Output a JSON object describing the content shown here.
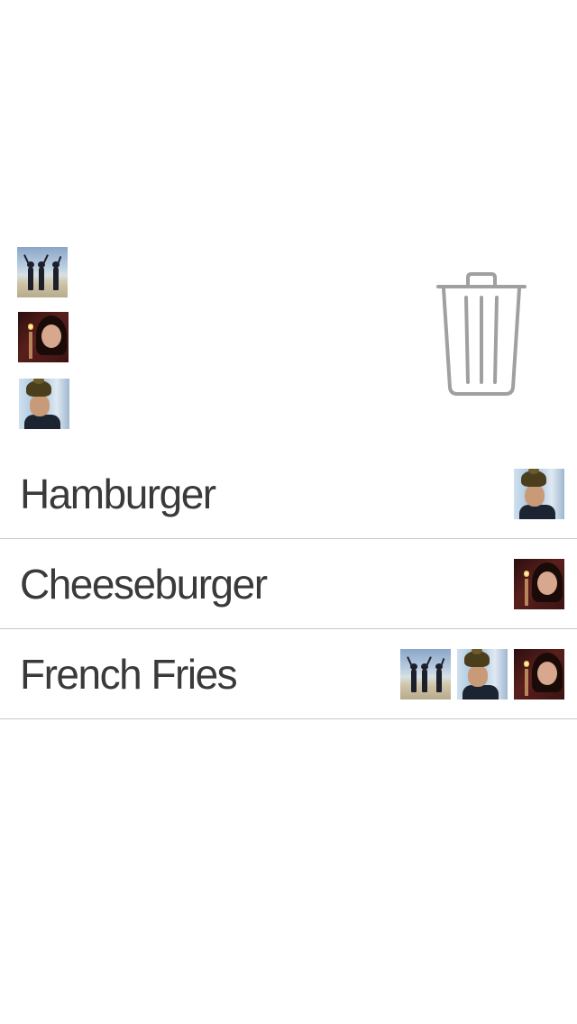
{
  "pool": {
    "avatars": [
      "beach-group",
      "woman-dinner",
      "man-hat"
    ]
  },
  "trash": {
    "icon": "trash-icon",
    "color": "#a0a0a0"
  },
  "list": {
    "items": [
      {
        "label": "Hamburger",
        "avatars": [
          "man-hat"
        ]
      },
      {
        "label": "Cheeseburger",
        "avatars": [
          "woman-dinner"
        ]
      },
      {
        "label": "French Fries",
        "avatars": [
          "beach-group",
          "man-hat",
          "woman-dinner"
        ]
      }
    ]
  },
  "colors": {
    "separator": "#c8c8cc",
    "label_text": "#3a3a3a",
    "background": "#ffffff"
  }
}
